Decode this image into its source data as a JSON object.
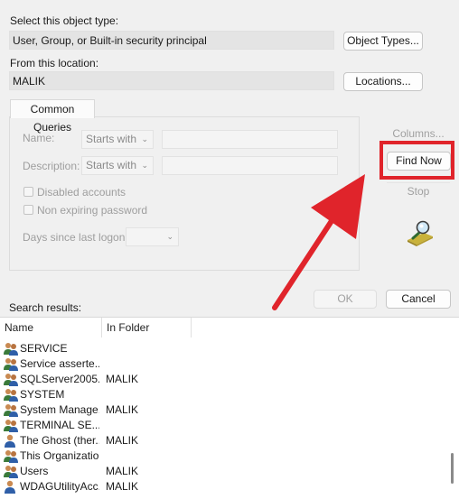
{
  "object_type": {
    "label": "Select this object type:",
    "value": "User, Group, or Built-in security principal",
    "button": "Object Types..."
  },
  "location": {
    "label": "From this location:",
    "value": "MALIK",
    "button": "Locations..."
  },
  "common_queries": {
    "tab_label": "Common Queries",
    "name_label": "Name:",
    "name_mode": "Starts with",
    "description_label": "Description:",
    "description_mode": "Starts with",
    "disabled_accounts": "Disabled accounts",
    "non_expiring": "Non expiring password",
    "days_label": "Days since last logon:"
  },
  "actions": {
    "columns": "Columns...",
    "find_now": "Find Now",
    "stop": "Stop",
    "ok": "OK",
    "cancel": "Cancel"
  },
  "annotation": {
    "highlight_color": "#e0242b",
    "arrow_color": "#e0242b"
  },
  "results": {
    "label": "Search results:",
    "columns": [
      "Name",
      "In Folder"
    ],
    "rows": [
      {
        "name": "SERVICE",
        "folder": "",
        "icon": "group-icon"
      },
      {
        "name": "Service asserte...",
        "folder": "",
        "icon": "group-icon"
      },
      {
        "name": "SQLServer2005...",
        "folder": "MALIK",
        "icon": "group-icon"
      },
      {
        "name": "SYSTEM",
        "folder": "",
        "icon": "group-icon"
      },
      {
        "name": "System Manage...",
        "folder": "MALIK",
        "icon": "group-icon"
      },
      {
        "name": "TERMINAL SE...",
        "folder": "",
        "icon": "group-icon"
      },
      {
        "name": "The Ghost (ther...",
        "folder": "MALIK",
        "icon": "user-icon"
      },
      {
        "name": "This Organizatio...",
        "folder": "",
        "icon": "group-icon"
      },
      {
        "name": "Users",
        "folder": "MALIK",
        "icon": "group-icon"
      },
      {
        "name": "WDAGUtilityAcc...",
        "folder": "MALIK",
        "icon": "user-icon"
      }
    ]
  }
}
